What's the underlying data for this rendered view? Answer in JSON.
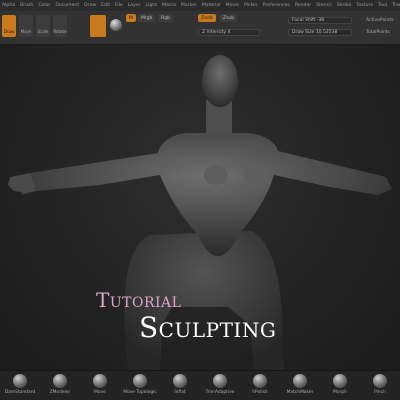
{
  "menu": [
    "Alpha",
    "Brush",
    "Color",
    "Document",
    "Draw",
    "Edit",
    "File",
    "Layer",
    "Light",
    "Macro",
    "Marker",
    "Material",
    "Movie",
    "Picker",
    "Preferences",
    "Render",
    "Stencil",
    "Stroke",
    "Texture",
    "Tool",
    "Transform",
    "Zplugin",
    "Zscript",
    "Help"
  ],
  "toolbar": {
    "draw_label": "Draw",
    "move_label": "Move",
    "scale_label": "Scale",
    "rotate_label": "Rotate",
    "mrgb_label": "Mrgb",
    "rgb_label": "Rgb",
    "m_label": "M",
    "zadd_label": "Zadd",
    "zsub_label": "Zsub",
    "z_intensity": "Z Intensity 4",
    "focal_shift": "Focal Shift -38",
    "draw_size": "Draw Size 10.52538",
    "activepoints": "ActivePoints",
    "totalpoints": "TotalPoints"
  },
  "brushes": [
    "DamStandard",
    "ZModeler",
    "Move",
    "Move Topologic",
    "Inflat",
    "TrimAdaptive",
    "hPolish",
    "MatchMaker",
    "Morph",
    "Pinch"
  ],
  "overlay": {
    "line1": "Tutorial",
    "line2": "Sculpting"
  },
  "colors": {
    "accent": "#c77a1e",
    "title_pink": "#d8a9c6"
  }
}
